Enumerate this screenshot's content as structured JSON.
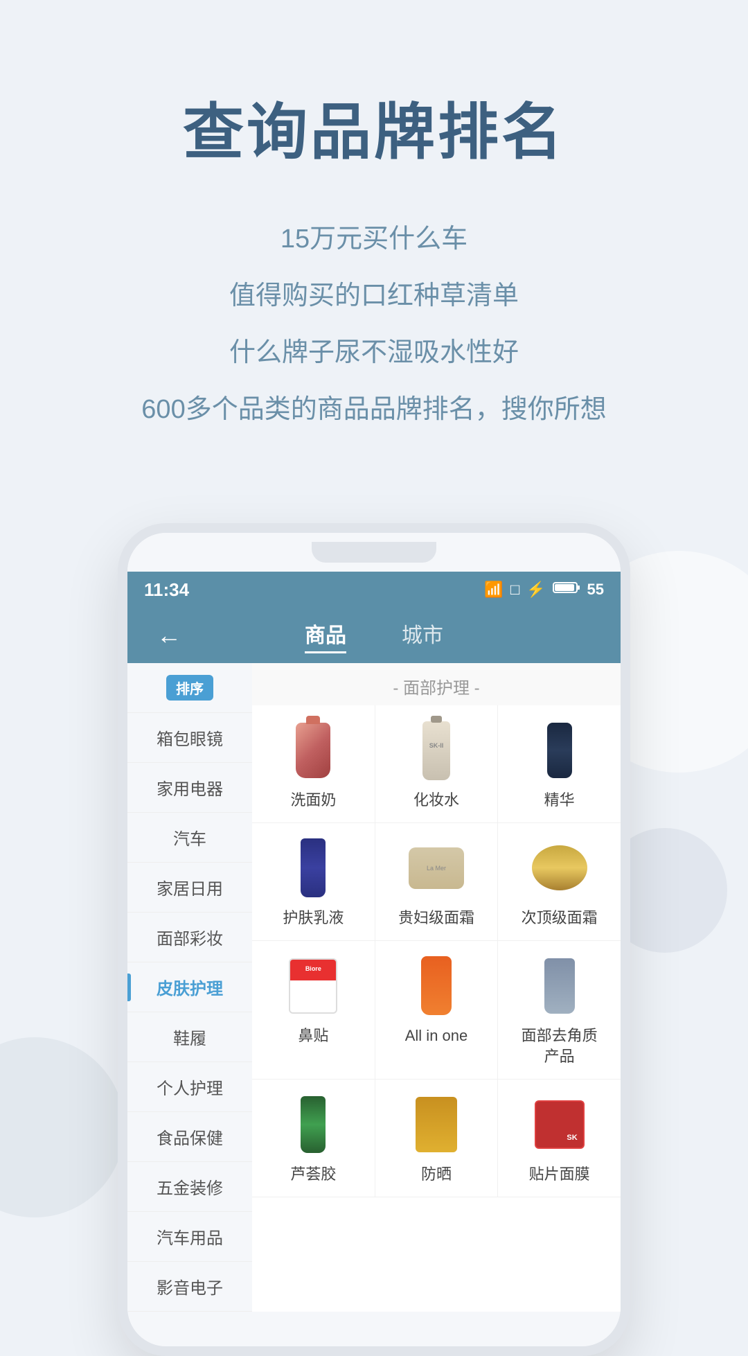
{
  "page": {
    "title": "查询品牌排名",
    "subtitle_lines": [
      "15万元买什么车",
      "值得购买的口红种草清单",
      "什么牌子尿不湿吸水性好",
      "600多个品类的商品品牌排名，搜你所想"
    ]
  },
  "phone": {
    "status": {
      "time": "11:34",
      "battery": "55"
    },
    "nav": {
      "back_icon": "←",
      "tabs": [
        {
          "label": "商品",
          "active": true
        },
        {
          "label": "城市",
          "active": false
        }
      ]
    },
    "sidebar": {
      "items": [
        {
          "label": "排序",
          "badge": true,
          "active": false
        },
        {
          "label": "箱包眼镜",
          "active": false
        },
        {
          "label": "家用电器",
          "active": false
        },
        {
          "label": "汽车",
          "active": false
        },
        {
          "label": "家居日用",
          "active": false
        },
        {
          "label": "面部彩妆",
          "active": false
        },
        {
          "label": "皮肤护理",
          "active": true
        },
        {
          "label": "鞋履",
          "active": false
        },
        {
          "label": "个人护理",
          "active": false
        },
        {
          "label": "食品保健",
          "active": false
        },
        {
          "label": "五金装修",
          "active": false
        },
        {
          "label": "汽车用品",
          "active": false
        },
        {
          "label": "影音电子",
          "active": false
        }
      ]
    },
    "sections": [
      {
        "header": "- 面部护理 -",
        "rows": [
          {
            "cells": [
              {
                "label": "洗面奶",
                "img_type": "cleanser"
              },
              {
                "label": "化妆水",
                "img_type": "toner"
              },
              {
                "label": "精华",
                "img_type": "serum"
              }
            ]
          },
          {
            "cells": [
              {
                "label": "护肤乳液",
                "img_type": "lotion"
              },
              {
                "label": "贵妇级面霜",
                "img_type": "cream-luxury"
              },
              {
                "label": "次顶级面霜",
                "img_type": "cream-mid"
              }
            ]
          },
          {
            "cells": [
              {
                "label": "鼻贴",
                "img_type": "nose-strips"
              },
              {
                "label": "All in one",
                "img_type": "allinone"
              },
              {
                "label": "面部去角质\n产品",
                "img_type": "exfoliant"
              }
            ]
          },
          {
            "cells": [
              {
                "label": "芦荟胶",
                "img_type": "aloe"
              },
              {
                "label": "防晒",
                "img_type": "sunscreen"
              },
              {
                "label": "贴片面膜",
                "img_type": "sheet-mask"
              }
            ]
          }
        ]
      }
    ]
  }
}
